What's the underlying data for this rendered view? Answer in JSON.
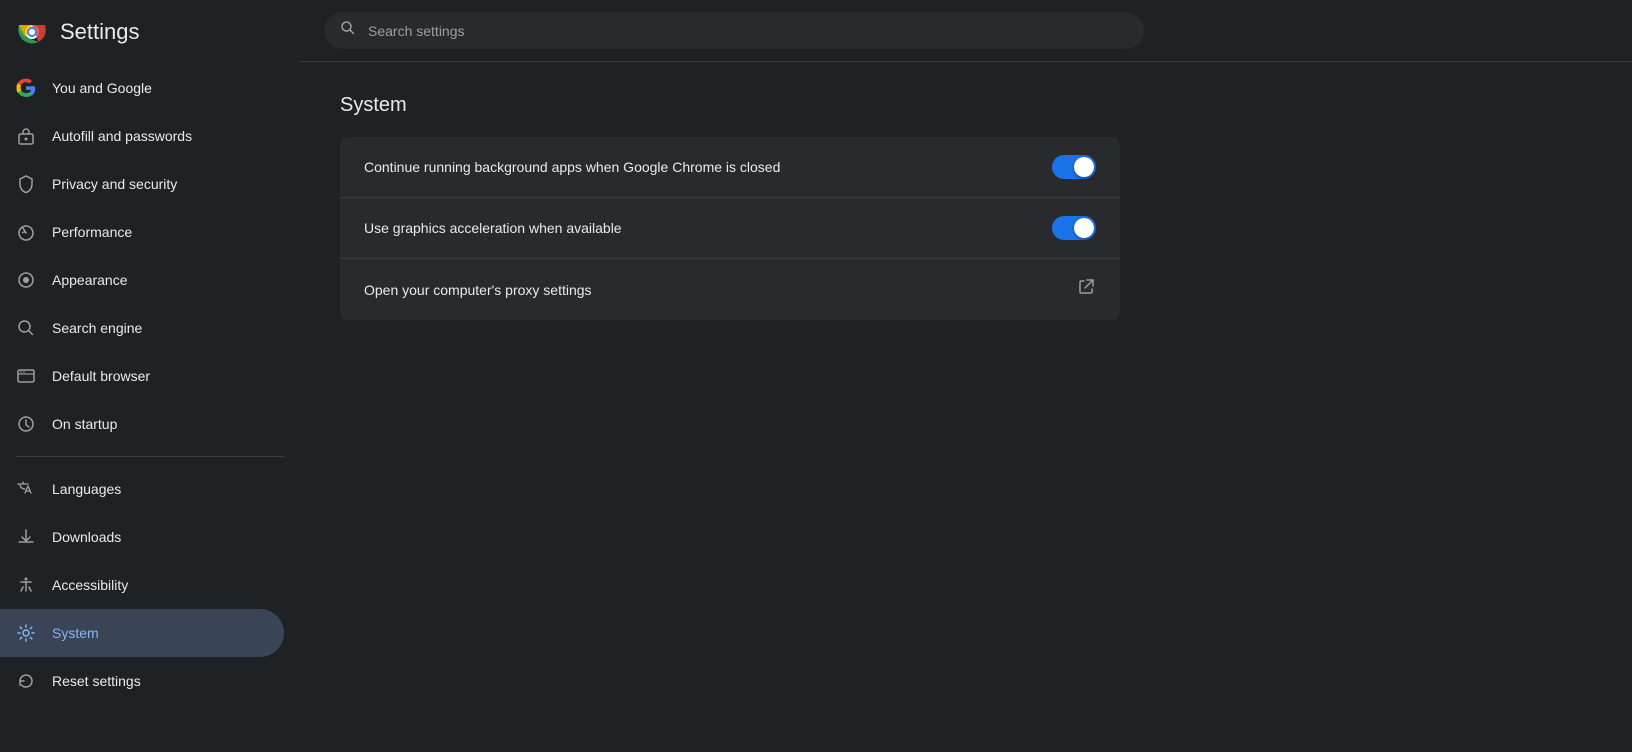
{
  "sidebar": {
    "title": "Settings",
    "nav_items": [
      {
        "id": "you-and-google",
        "label": "You and Google",
        "icon": "google",
        "active": false
      },
      {
        "id": "autofill",
        "label": "Autofill and passwords",
        "icon": "autofill",
        "active": false
      },
      {
        "id": "privacy",
        "label": "Privacy and security",
        "icon": "shield",
        "active": false
      },
      {
        "id": "performance",
        "label": "Performance",
        "icon": "performance",
        "active": false
      },
      {
        "id": "appearance",
        "label": "Appearance",
        "icon": "appearance",
        "active": false
      },
      {
        "id": "search-engine",
        "label": "Search engine",
        "icon": "search",
        "active": false
      },
      {
        "id": "default-browser",
        "label": "Default browser",
        "icon": "browser",
        "active": false
      },
      {
        "id": "on-startup",
        "label": "On startup",
        "icon": "startup",
        "active": false
      },
      {
        "id": "languages",
        "label": "Languages",
        "icon": "languages",
        "active": false
      },
      {
        "id": "downloads",
        "label": "Downloads",
        "icon": "downloads",
        "active": false
      },
      {
        "id": "accessibility",
        "label": "Accessibility",
        "icon": "accessibility",
        "active": false
      },
      {
        "id": "system",
        "label": "System",
        "icon": "system",
        "active": true
      },
      {
        "id": "reset-settings",
        "label": "Reset settings",
        "icon": "reset",
        "active": false
      }
    ]
  },
  "search": {
    "placeholder": "Search settings"
  },
  "main": {
    "section_title": "System",
    "settings": [
      {
        "id": "background-apps",
        "label": "Continue running background apps when Google Chrome is closed",
        "type": "toggle",
        "value": true
      },
      {
        "id": "gpu-acceleration",
        "label": "Use graphics acceleration when available",
        "type": "toggle",
        "value": true
      },
      {
        "id": "proxy-settings",
        "label": "Open your computer's proxy settings",
        "type": "external-link",
        "value": null
      }
    ]
  }
}
